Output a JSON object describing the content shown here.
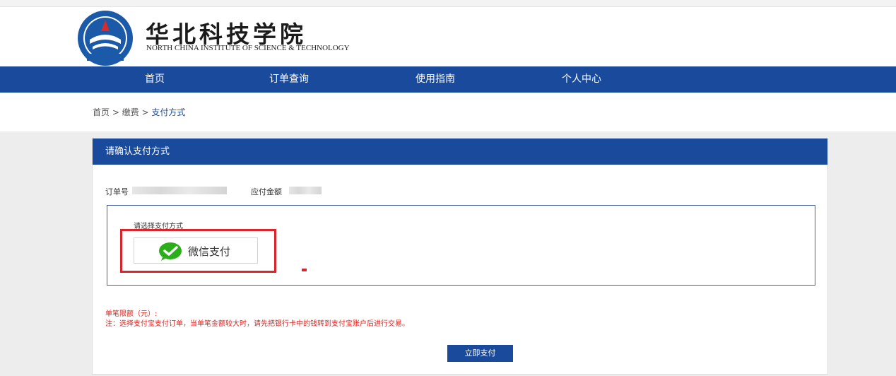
{
  "header": {
    "logo_title": "华北科技学院",
    "logo_subtitle": "NORTH CHINA INSTITUTE OF SCIENCE & TECHNOLOGY",
    "emblem_text": "华北科技学院"
  },
  "nav": {
    "items": [
      {
        "label": "首页"
      },
      {
        "label": "订单查询"
      },
      {
        "label": "使用指南"
      },
      {
        "label": "个人中心"
      }
    ]
  },
  "breadcrumb": {
    "home": "首页",
    "sep1": " > ",
    "fee": "缴费",
    "sep2": " > ",
    "current": "支付方式"
  },
  "panel": {
    "title": "请确认支付方式",
    "order_label": "订单号",
    "amount_label": "应付金额",
    "choose_label": "请选择支付方式",
    "wechat_label": "微信支付",
    "limit_label": "单笔限额（元）:",
    "note": "注：选择支付宝支付订单，当单笔金额较大时，请先把银行卡中的钱转到支付宝账户后进行交易。",
    "pay_button": "立即支付"
  },
  "colors": {
    "brand_blue": "#1a4a9c",
    "highlight_red": "#d9252b",
    "wechat_green": "#2aae1a",
    "note_red": "#e0231f"
  }
}
